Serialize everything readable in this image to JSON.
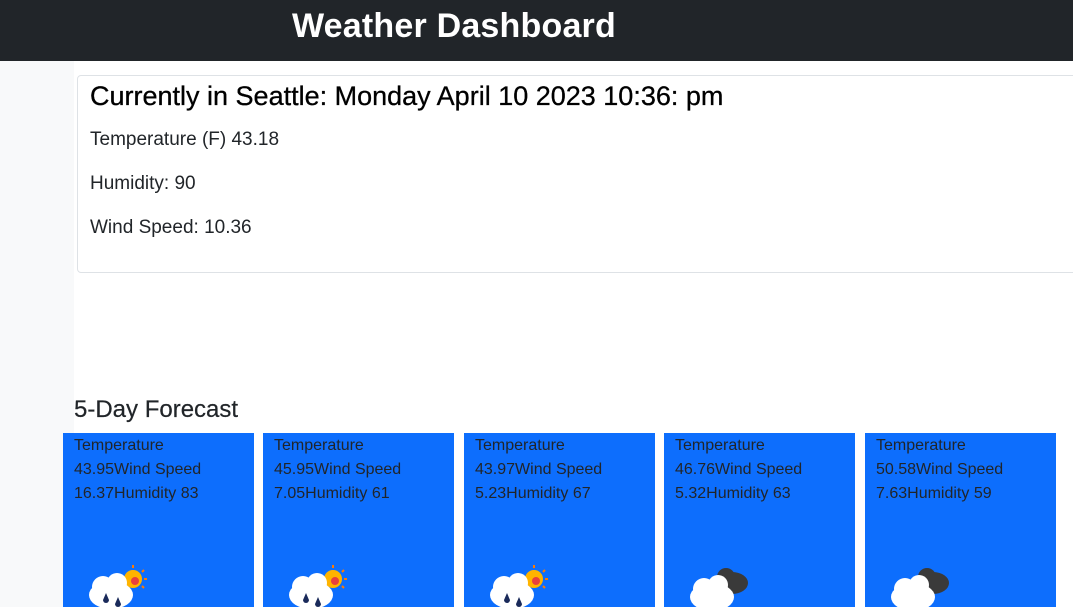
{
  "header": {
    "title": "Weather Dashboard"
  },
  "current": {
    "heading": "Currently in Seattle: Monday April 10 2023 10:36: pm",
    "temperature": "Temperature (F) 43.18",
    "humidity": "Humidity: 90",
    "wind": "Wind Speed: 10.36"
  },
  "forecast": {
    "title": "5-Day Forecast",
    "days": [
      {
        "line1": "Temperature",
        "line2": "43.95Wind Speed",
        "line3": "16.37Humidity 83",
        "icon": "rain-sun-icon"
      },
      {
        "line1": "Temperature",
        "line2": "45.95Wind Speed",
        "line3": "7.05Humidity 61",
        "icon": "rain-sun-icon"
      },
      {
        "line1": "Temperature",
        "line2": "43.97Wind Speed",
        "line3": "5.23Humidity 67",
        "icon": "rain-sun-icon"
      },
      {
        "line1": "Temperature",
        "line2": "46.76Wind Speed",
        "line3": "5.32Humidity 63",
        "icon": "cloudy-icon"
      },
      {
        "line1": "Temperature",
        "line2": "50.58Wind Speed",
        "line3": "7.63Humidity 59",
        "icon": "cloudy-icon"
      }
    ]
  },
  "colors": {
    "header_bg": "#212529",
    "card_bg": "#0d6efd",
    "sidebar_bg": "#f8f9fa"
  }
}
